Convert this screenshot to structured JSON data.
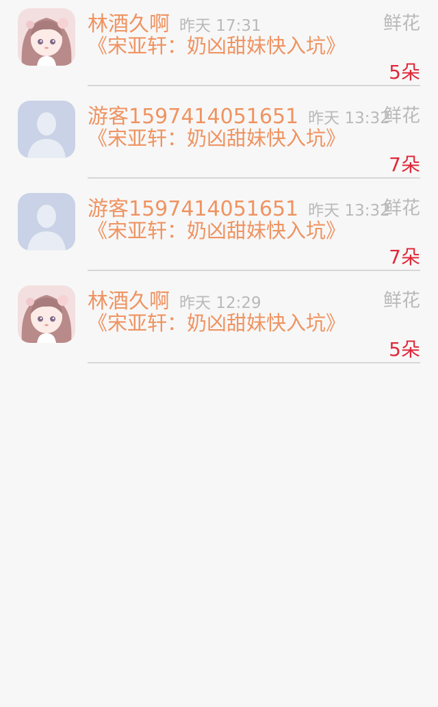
{
  "colors": {
    "background": "#f7f7f7",
    "name_text": "#ef9361",
    "meta_text": "#b9b9b9",
    "count_text": "#e0283a",
    "divider": "#d6d6d6"
  },
  "gifts": [
    {
      "avatar": "anime-girl-avatar",
      "user_name": "林酒久啊",
      "time": "昨天 17:31",
      "gift_type": "鲜花",
      "work_title": "《宋亚轩：奶凶甜妹快入坑》",
      "gift_count": "5朵"
    },
    {
      "avatar": "default-user-avatar",
      "user_name": "游客1597414051651",
      "time": "昨天 13:32",
      "gift_type": "鲜花",
      "work_title": "《宋亚轩：奶凶甜妹快入坑》",
      "gift_count": "7朵"
    },
    {
      "avatar": "default-user-avatar",
      "user_name": "游客1597414051651",
      "time": "昨天 13:32",
      "gift_type": "鲜花",
      "work_title": "《宋亚轩：奶凶甜妹快入坑》",
      "gift_count": "7朵"
    },
    {
      "avatar": "anime-girl-avatar",
      "user_name": "林酒久啊",
      "time": "昨天 12:29",
      "gift_type": "鲜花",
      "work_title": "《宋亚轩：奶凶甜妹快入坑》",
      "gift_count": "5朵"
    }
  ]
}
